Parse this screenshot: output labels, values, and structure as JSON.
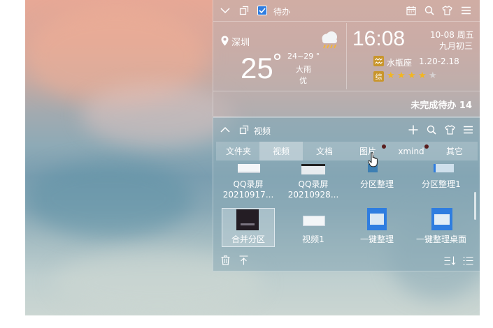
{
  "todo_panel": {
    "title": "待办",
    "weather": {
      "city": "深圳",
      "temp": "25",
      "degree": "°",
      "range": "24~29 °",
      "condition": "大雨",
      "air_quality": "优"
    },
    "clock": {
      "time": "16:08",
      "date": "10-08 周五",
      "lunar": "九月初三",
      "zodiac": "水瓶座",
      "zodiac_range": "1.20-2.18",
      "fortune_badge": "综",
      "fortune_stars": 4,
      "fortune_max": 5
    },
    "pending": "未完成待办 14"
  },
  "video_panel": {
    "title": "视频",
    "tabs": [
      {
        "label": "文件夹"
      },
      {
        "label": "视频"
      },
      {
        "label": "文档"
      },
      {
        "label": "图片"
      },
      {
        "label": "xmind"
      },
      {
        "label": "其它"
      }
    ],
    "active_tab": "视频",
    "row1": [
      {
        "line1": "QQ录屏",
        "line2": "20210917..."
      },
      {
        "line1": "QQ录屏",
        "line2": "20210928..."
      },
      {
        "line1": "分区整理",
        "line2": ""
      },
      {
        "line1": "分区整理1",
        "line2": ""
      }
    ],
    "row2": [
      {
        "name": "合并分区"
      },
      {
        "name": "视频1"
      },
      {
        "name": "一键整理"
      },
      {
        "name": "一键整理桌面"
      }
    ]
  },
  "colors": {
    "star": "#f3b61f",
    "badge_bg": "#c9962c",
    "selected_border": "#dfe9ee"
  }
}
